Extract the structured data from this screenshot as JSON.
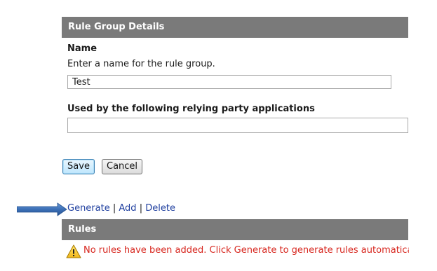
{
  "details_section": {
    "header": "Rule Group Details"
  },
  "name_field": {
    "label": "Name",
    "hint": "Enter a name for the rule group.",
    "value": "Test"
  },
  "rp_field": {
    "label": "Used by the following relying party applications",
    "value": ""
  },
  "actions": {
    "save_label": "Save",
    "cancel_label": "Cancel"
  },
  "rule_links": {
    "generate": "Generate",
    "separator": "|",
    "add": "Add",
    "delete": "Delete"
  },
  "rules_section": {
    "header": "Rules",
    "warning": "No rules have been added. Click Generate to generate rules automatically, o"
  },
  "colors": {
    "header_bg": "#7a7a7a",
    "link": "#1f3f9f",
    "warning_text": "#d7261e",
    "arrow": "#3b6fb6"
  },
  "icons": {
    "arrow": "right-arrow-icon",
    "warning": "warning-icon"
  }
}
